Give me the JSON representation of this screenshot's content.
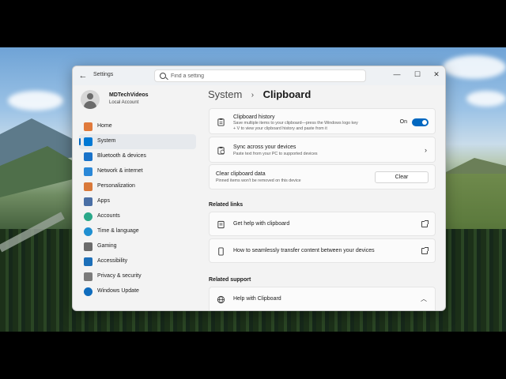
{
  "window": {
    "app_title": "Settings",
    "search_placeholder": "Find a setting"
  },
  "profile": {
    "name": "MDTechVideos",
    "account_type": "Local Account"
  },
  "sidebar": {
    "items": [
      {
        "label": "Home",
        "icon": "home-icon",
        "color": "#e07a3c",
        "active": false
      },
      {
        "label": "System",
        "icon": "monitor-icon",
        "color": "#0078d4",
        "active": true
      },
      {
        "label": "Bluetooth & devices",
        "icon": "bluetooth-icon",
        "color": "#1a73c9",
        "active": false
      },
      {
        "label": "Network & internet",
        "icon": "wifi-icon",
        "color": "#2b88d8",
        "active": false
      },
      {
        "label": "Personalization",
        "icon": "brush-icon",
        "color": "#d9793a",
        "active": false
      },
      {
        "label": "Apps",
        "icon": "apps-icon",
        "color": "#4a6fa5",
        "active": false
      },
      {
        "label": "Accounts",
        "icon": "person-icon",
        "color": "#2aa889",
        "active": false
      },
      {
        "label": "Time & language",
        "icon": "globe-clock-icon",
        "color": "#1f8fd1",
        "active": false
      },
      {
        "label": "Gaming",
        "icon": "gamepad-icon",
        "color": "#6b6b6b",
        "active": false
      },
      {
        "label": "Accessibility",
        "icon": "accessibility-icon",
        "color": "#1c6fb9",
        "active": false
      },
      {
        "label": "Privacy & security",
        "icon": "shield-icon",
        "color": "#7b7b7b",
        "active": false
      },
      {
        "label": "Windows Update",
        "icon": "update-icon",
        "color": "#0f6cbd",
        "active": false
      }
    ]
  },
  "breadcrumb": {
    "parent": "System",
    "separator": "›",
    "current": "Clipboard"
  },
  "clipboard_history": {
    "title": "Clipboard history",
    "desc_line1": "Save multiple items to your clipboard—press the Windows logo key",
    "desc_line2": "+ V to view your clipboard history and paste from it",
    "state_label": "On"
  },
  "sync": {
    "title": "Sync across your devices",
    "desc": "Paste text from your PC to supported devices"
  },
  "clear_data": {
    "title": "Clear clipboard data",
    "desc": "Pinned items won't be removed on this device",
    "button_label": "Clear"
  },
  "related_links": {
    "heading": "Related links",
    "items": [
      {
        "label": "Get help with clipboard"
      },
      {
        "label": "How to seamlessly transfer content between your devices"
      }
    ]
  },
  "related_support": {
    "heading": "Related support",
    "item_label": "Help with Clipboard"
  }
}
